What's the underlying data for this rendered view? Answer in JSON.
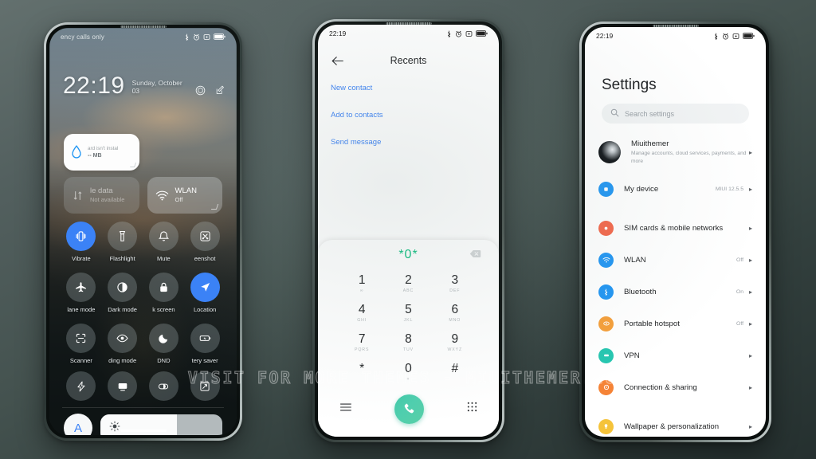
{
  "background": {
    "color_top": "#63706e",
    "color_bottom": "#25302f"
  },
  "watermark": {
    "text": "VISIT FOR MORE THEMES - MIUITHEMER.COM"
  },
  "status_bar": {
    "time": "22:19",
    "icons": [
      "bluetooth-icon",
      "alarm-icon",
      "silent-icon",
      "battery-icon"
    ]
  },
  "lock_screen": {
    "carrier": "ency calls only",
    "clock": {
      "time": "22:19",
      "date": "Sunday, October 03"
    },
    "clock_icons": [
      "camera-icon",
      "edit-icon"
    ],
    "widget": {
      "icon": "water-drop-icon",
      "title": "ard isn't instal",
      "subtitle": "-- MB"
    },
    "big_tiles": [
      {
        "icon": "mobile-data-icon",
        "title": "le data",
        "subtitle": "Not available",
        "active": false
      },
      {
        "icon": "wlan-icon",
        "title": "WLAN",
        "subtitle": "Off",
        "active": false
      }
    ],
    "toggles": [
      {
        "label": "Vibrate",
        "icon": "vibrate-icon",
        "on": true
      },
      {
        "label": "Flashlight",
        "icon": "flashlight-icon",
        "on": false
      },
      {
        "label": "Mute",
        "icon": "bell-icon",
        "on": false
      },
      {
        "label": "eenshot",
        "icon": "screenshot-icon",
        "on": false
      },
      {
        "label": "lane mode",
        "icon": "airplane-icon",
        "on": false
      },
      {
        "label": "Dark mode",
        "icon": "contrast-icon",
        "on": false
      },
      {
        "label": "k screen",
        "icon": "lock-icon",
        "on": false
      },
      {
        "label": "Location",
        "icon": "location-icon",
        "on": true
      },
      {
        "label": "Scanner",
        "icon": "scanner-icon",
        "on": false
      },
      {
        "label": "ding mode",
        "icon": "eye-icon",
        "on": false
      },
      {
        "label": "DND",
        "icon": "moon-icon",
        "on": false
      },
      {
        "label": "tery saver",
        "icon": "battery-saver-icon",
        "on": false
      }
    ],
    "toggles_row2": [
      {
        "icon": "lightning-icon"
      },
      {
        "icon": "cast-icon"
      },
      {
        "icon": "reading-icon"
      },
      {
        "icon": "expand-icon"
      }
    ],
    "brightness": {
      "auto_label": "A",
      "icon": "brightness-icon",
      "level_percent": 63
    }
  },
  "recents_screen": {
    "title": "Recents",
    "back_icon": "back-arrow-icon",
    "links": [
      {
        "label": "New contact"
      },
      {
        "label": "Add to contacts"
      },
      {
        "label": "Send message"
      }
    ],
    "dialer": {
      "number": "*0*",
      "delete_icon": "backspace-icon",
      "keys": [
        {
          "digit": "1",
          "sub": ""
        },
        {
          "digit": "2",
          "sub": "ABC"
        },
        {
          "digit": "3",
          "sub": "DEF"
        },
        {
          "digit": "4",
          "sub": "GHI"
        },
        {
          "digit": "5",
          "sub": "JKL"
        },
        {
          "digit": "6",
          "sub": "MNO"
        },
        {
          "digit": "7",
          "sub": "PQRS"
        },
        {
          "digit": "8",
          "sub": "TUV"
        },
        {
          "digit": "9",
          "sub": "WXYZ"
        },
        {
          "digit": "*",
          "sub": ""
        },
        {
          "digit": "0",
          "sub": "+"
        },
        {
          "digit": "#",
          "sub": ""
        }
      ],
      "actions": [
        "menu-icon",
        "call-icon",
        "keypad-icon"
      ],
      "call_color": "#4ecba4",
      "number_color": "#0bbd7e"
    }
  },
  "settings_screen": {
    "title": "Settings",
    "search": {
      "placeholder": "Search settings",
      "icon": "search-icon"
    },
    "account": {
      "name": "Miuithemer",
      "desc": "Manage accounts, cloud services, payments, and more",
      "icon": "avatar"
    },
    "items": [
      {
        "label": "My device",
        "value": "MIUI 12.5.5",
        "icon": "device-icon",
        "color": "#2196f3"
      },
      {
        "label": "SIM cards & mobile networks",
        "value": "",
        "icon": "sim-icon",
        "color": "#f4674a"
      },
      {
        "label": "WLAN",
        "value": "Off",
        "icon": "wlan-icon",
        "color": "#2196f3"
      },
      {
        "label": "Bluetooth",
        "value": "On",
        "icon": "bluetooth-icon",
        "color": "#2196f3"
      },
      {
        "label": "Portable hotspot",
        "value": "Off",
        "icon": "hotspot-icon",
        "color": "#f59f3a"
      },
      {
        "label": "VPN",
        "value": "",
        "icon": "vpn-icon",
        "color": "#26c6b0"
      },
      {
        "label": "Connection & sharing",
        "value": "",
        "icon": "sharing-icon",
        "color": "#f58336"
      },
      {
        "label": "Wallpaper & personalization",
        "value": "",
        "icon": "wallpaper-icon",
        "color": "#f5c33a"
      }
    ],
    "chevron": "▸"
  }
}
